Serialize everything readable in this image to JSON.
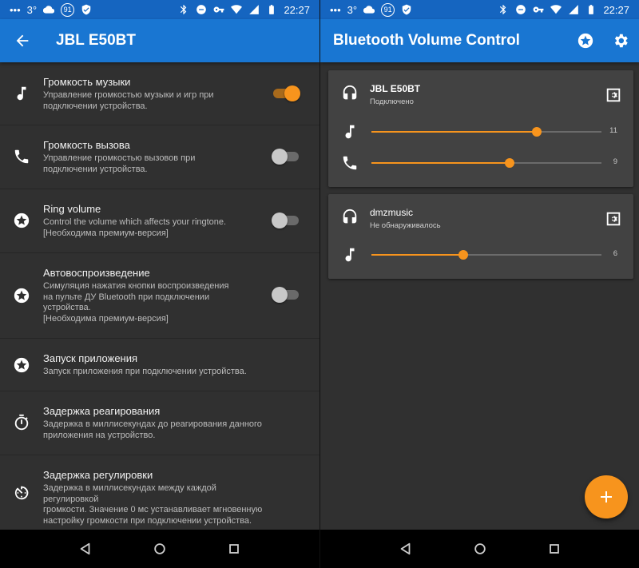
{
  "status_bar": {
    "left_screen": {
      "temperature": "3°",
      "badge": "91",
      "time": "22:27"
    },
    "right_screen": {
      "temperature": "3°",
      "badge": "91",
      "time": "22:27"
    }
  },
  "left_screen": {
    "title": "JBL E50BT",
    "settings": [
      {
        "title": "Громкость музыки",
        "summary": "Управление громкостью музыки и игр при\nподключении устройства.",
        "icon": "music-note-icon",
        "toggle": true
      },
      {
        "title": "Громкость вызова",
        "summary": "Управление громкостью вызовов при\nподключении устройства.",
        "icon": "phone-icon",
        "toggle": false
      },
      {
        "title": "Ring volume",
        "summary": "Control the volume which affects your ringtone.\n[Необходима премиум-версия]",
        "icon": "star-icon",
        "toggle": false
      },
      {
        "title": "Автовоспроизведение",
        "summary": "Симуляция нажатия кнопки воспроизведения\nна пульте ДУ Bluetooth при подключении\nустройства.\n[Необходима премиум-версия]",
        "icon": "star-icon",
        "toggle": false
      },
      {
        "title": "Запуск приложения",
        "summary": "Запуск приложения при подключении устройства.",
        "icon": "star-icon"
      },
      {
        "title": "Задержка реагирования",
        "summary": "Задержка в миллисекундах до реагирования данного\nприложения на устройство.",
        "icon": "stopwatch-icon"
      },
      {
        "title": "Задержка регулировки",
        "summary": "Задержка в миллисекундах между каждой регулировкой\nгромкости. Значение 0 мс устанавливает мгновенную\nнастройку громкости при подключении устройства.",
        "icon": "timer-icon"
      }
    ]
  },
  "right_screen": {
    "title": "Bluetooth Volume Control",
    "devices": [
      {
        "name": "JBL E50BT",
        "status": "Подключено",
        "sliders": [
          {
            "icon": "music-note-icon",
            "value": "11",
            "level": 0.72
          },
          {
            "icon": "phone-icon",
            "value": "9",
            "level": 0.6
          }
        ]
      },
      {
        "name": "dmzmusic",
        "status": "Не обнаруживалось",
        "sliders": [
          {
            "icon": "music-note-icon",
            "value": "6",
            "level": 0.4
          }
        ]
      }
    ]
  },
  "colors": {
    "status_bar": "#1565c0",
    "app_bar": "#1976d2",
    "background": "#303030",
    "card": "#424242",
    "accent": "#f7941d"
  }
}
